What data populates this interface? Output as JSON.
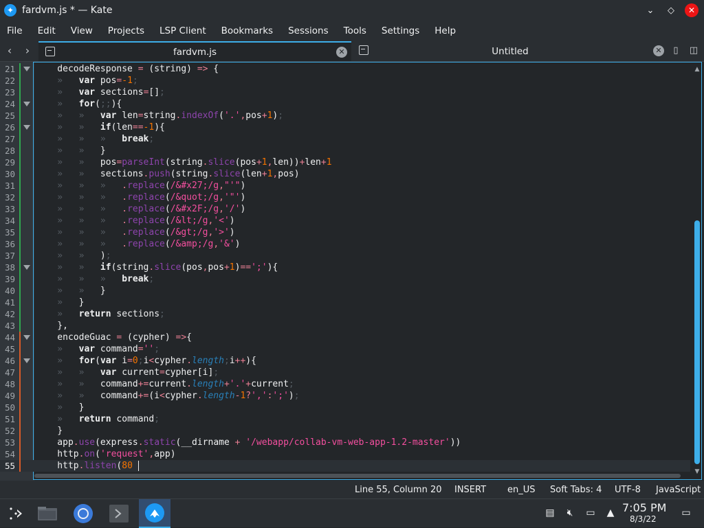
{
  "window": {
    "title": "fardvm.js * — Kate"
  },
  "menu": [
    "File",
    "Edit",
    "View",
    "Projects",
    "LSP Client",
    "Bookmarks",
    "Sessions",
    "Tools",
    "Settings",
    "Help"
  ],
  "tabs": [
    {
      "label": "fardvm.js"
    },
    {
      "label": "Untitled"
    }
  ],
  "editor": {
    "lines": [
      {
        "n": "21",
        "fold": true,
        "mod": "green",
        "tokens": [
          [
            "var",
            "    decodeResponse "
          ],
          [
            "op",
            "="
          ],
          [
            "var",
            " (string) "
          ],
          [
            "op",
            "=>"
          ],
          [
            "var",
            " {"
          ]
        ]
      },
      {
        "n": "22",
        "fold": false,
        "mod": "green",
        "tokens": [
          [
            "ws",
            "    »   "
          ],
          [
            "kw",
            "var"
          ],
          [
            "var",
            " pos"
          ],
          [
            "op",
            "="
          ],
          [
            "num",
            "-1"
          ],
          [
            "ws",
            ";"
          ]
        ]
      },
      {
        "n": "23",
        "fold": false,
        "mod": "green",
        "tokens": [
          [
            "ws",
            "    »   "
          ],
          [
            "kw",
            "var"
          ],
          [
            "var",
            " sections"
          ],
          [
            "op",
            "="
          ],
          [
            "var",
            "[]"
          ],
          [
            "ws",
            ";"
          ]
        ]
      },
      {
        "n": "24",
        "fold": true,
        "mod": "green",
        "tokens": [
          [
            "ws",
            "    »   "
          ],
          [
            "kw",
            "for"
          ],
          [
            "var",
            "("
          ],
          [
            "ws",
            ";;"
          ],
          [
            "var",
            "){"
          ]
        ]
      },
      {
        "n": "25",
        "fold": false,
        "mod": "green",
        "tokens": [
          [
            "ws",
            "    »   »   "
          ],
          [
            "kw",
            "var"
          ],
          [
            "var",
            " len"
          ],
          [
            "op",
            "="
          ],
          [
            "var",
            "string"
          ],
          [
            "op",
            "."
          ],
          [
            "fn",
            "indexOf"
          ],
          [
            "var",
            "("
          ],
          [
            "str",
            "'.'"
          ],
          [
            "op",
            ","
          ],
          [
            "var",
            "pos"
          ],
          [
            "op",
            "+"
          ],
          [
            "num",
            "1"
          ],
          [
            "var",
            ")"
          ],
          [
            "ws",
            ";"
          ]
        ]
      },
      {
        "n": "26",
        "fold": true,
        "mod": "green",
        "tokens": [
          [
            "ws",
            "    »   »   "
          ],
          [
            "kw",
            "if"
          ],
          [
            "var",
            "(len"
          ],
          [
            "op",
            "=="
          ],
          [
            "num",
            "-1"
          ],
          [
            "var",
            "){"
          ]
        ]
      },
      {
        "n": "27",
        "fold": false,
        "mod": "green",
        "tokens": [
          [
            "ws",
            "    »   »   »   "
          ],
          [
            "kw",
            "break"
          ],
          [
            "ws",
            ";"
          ]
        ]
      },
      {
        "n": "28",
        "fold": false,
        "mod": "green",
        "tokens": [
          [
            "ws",
            "    »   »   "
          ],
          [
            "var",
            "}"
          ]
        ]
      },
      {
        "n": "29",
        "fold": false,
        "mod": "green",
        "tokens": [
          [
            "ws",
            "    »   »   "
          ],
          [
            "var",
            "pos"
          ],
          [
            "op",
            "="
          ],
          [
            "fn",
            "parseInt"
          ],
          [
            "var",
            "(string"
          ],
          [
            "op",
            "."
          ],
          [
            "fn",
            "slice"
          ],
          [
            "var",
            "(pos"
          ],
          [
            "op",
            "+"
          ],
          [
            "num",
            "1"
          ],
          [
            "op",
            ","
          ],
          [
            "var",
            "len))"
          ],
          [
            "op",
            "+"
          ],
          [
            "var",
            "len"
          ],
          [
            "op",
            "+"
          ],
          [
            "num",
            "1"
          ]
        ]
      },
      {
        "n": "30",
        "fold": false,
        "mod": "green",
        "tokens": [
          [
            "ws",
            "    »   »   "
          ],
          [
            "var",
            "sections"
          ],
          [
            "op",
            "."
          ],
          [
            "fn",
            "push"
          ],
          [
            "var",
            "(string"
          ],
          [
            "op",
            "."
          ],
          [
            "fn",
            "slice"
          ],
          [
            "var",
            "(len"
          ],
          [
            "op",
            "+"
          ],
          [
            "num",
            "1"
          ],
          [
            "op",
            ","
          ],
          [
            "var",
            "pos)"
          ]
        ]
      },
      {
        "n": "31",
        "fold": false,
        "mod": "green",
        "tokens": [
          [
            "ws",
            "    »   »   »   "
          ],
          [
            "op",
            "."
          ],
          [
            "fn",
            "replace"
          ],
          [
            "var",
            "("
          ],
          [
            "str",
            "/&#x27;/g"
          ],
          [
            "op",
            ","
          ],
          [
            "str",
            "\"'\""
          ],
          [
            "var",
            ")"
          ]
        ]
      },
      {
        "n": "32",
        "fold": false,
        "mod": "green",
        "tokens": [
          [
            "ws",
            "    »   »   »   "
          ],
          [
            "op",
            "."
          ],
          [
            "fn",
            "replace"
          ],
          [
            "var",
            "("
          ],
          [
            "str",
            "/&quot;/g"
          ],
          [
            "op",
            ","
          ],
          [
            "str",
            "'\"'"
          ],
          [
            "var",
            ")"
          ]
        ]
      },
      {
        "n": "33",
        "fold": false,
        "mod": "green",
        "tokens": [
          [
            "ws",
            "    »   »   »   "
          ],
          [
            "op",
            "."
          ],
          [
            "fn",
            "replace"
          ],
          [
            "var",
            "("
          ],
          [
            "str",
            "/&#x2F;/g"
          ],
          [
            "op",
            ","
          ],
          [
            "str",
            "'/'"
          ],
          [
            "var",
            ")"
          ]
        ]
      },
      {
        "n": "34",
        "fold": false,
        "mod": "green",
        "tokens": [
          [
            "ws",
            "    »   »   »   "
          ],
          [
            "op",
            "."
          ],
          [
            "fn",
            "replace"
          ],
          [
            "var",
            "("
          ],
          [
            "str",
            "/&lt;/g"
          ],
          [
            "op",
            ","
          ],
          [
            "str",
            "'<'"
          ],
          [
            "var",
            ")"
          ]
        ]
      },
      {
        "n": "35",
        "fold": false,
        "mod": "green",
        "tokens": [
          [
            "ws",
            "    »   »   »   "
          ],
          [
            "op",
            "."
          ],
          [
            "fn",
            "replace"
          ],
          [
            "var",
            "("
          ],
          [
            "str",
            "/&gt;/g"
          ],
          [
            "op",
            ","
          ],
          [
            "str",
            "'>'"
          ],
          [
            "var",
            ")"
          ]
        ]
      },
      {
        "n": "36",
        "fold": false,
        "mod": "green",
        "tokens": [
          [
            "ws",
            "    »   »   »   "
          ],
          [
            "op",
            "."
          ],
          [
            "fn",
            "replace"
          ],
          [
            "var",
            "("
          ],
          [
            "str",
            "/&amp;/g"
          ],
          [
            "op",
            ","
          ],
          [
            "str",
            "'&'"
          ],
          [
            "var",
            ")"
          ]
        ]
      },
      {
        "n": "37",
        "fold": false,
        "mod": "green",
        "tokens": [
          [
            "ws",
            "    »   »   "
          ],
          [
            "var",
            ")"
          ],
          [
            "ws",
            ";"
          ]
        ]
      },
      {
        "n": "38",
        "fold": true,
        "mod": "green",
        "tokens": [
          [
            "ws",
            "    »   »   "
          ],
          [
            "kw",
            "if"
          ],
          [
            "var",
            "(string"
          ],
          [
            "op",
            "."
          ],
          [
            "fn",
            "slice"
          ],
          [
            "var",
            "(pos"
          ],
          [
            "op",
            ","
          ],
          [
            "var",
            "pos"
          ],
          [
            "op",
            "+"
          ],
          [
            "num",
            "1"
          ],
          [
            "var",
            ")"
          ],
          [
            "op",
            "=="
          ],
          [
            "str",
            "';'"
          ],
          [
            "var",
            "){"
          ]
        ]
      },
      {
        "n": "39",
        "fold": false,
        "mod": "green",
        "tokens": [
          [
            "ws",
            "    »   »   »   "
          ],
          [
            "kw",
            "break"
          ],
          [
            "ws",
            ";"
          ]
        ]
      },
      {
        "n": "40",
        "fold": false,
        "mod": "green",
        "tokens": [
          [
            "ws",
            "    »   »   "
          ],
          [
            "var",
            "}"
          ]
        ]
      },
      {
        "n": "41",
        "fold": false,
        "mod": "green",
        "tokens": [
          [
            "ws",
            "    »   "
          ],
          [
            "var",
            "}"
          ]
        ]
      },
      {
        "n": "42",
        "fold": false,
        "mod": "green",
        "tokens": [
          [
            "ws",
            "    »   "
          ],
          [
            "kw",
            "return"
          ],
          [
            "var",
            " sections"
          ],
          [
            "ws",
            ";"
          ]
        ]
      },
      {
        "n": "43",
        "fold": false,
        "mod": "green",
        "tokens": [
          [
            "var",
            "    },"
          ]
        ]
      },
      {
        "n": "44",
        "fold": true,
        "mod": "orange",
        "tokens": [
          [
            "var",
            "    encodeGuac "
          ],
          [
            "op",
            "="
          ],
          [
            "var",
            " (cypher) "
          ],
          [
            "op",
            "=>"
          ],
          [
            "var",
            "{"
          ]
        ]
      },
      {
        "n": "45",
        "fold": false,
        "mod": "orange",
        "tokens": [
          [
            "ws",
            "    »   "
          ],
          [
            "kw",
            "var"
          ],
          [
            "var",
            " command"
          ],
          [
            "op",
            "="
          ],
          [
            "str",
            "''"
          ],
          [
            "ws",
            ";"
          ]
        ]
      },
      {
        "n": "46",
        "fold": true,
        "mod": "orange",
        "tokens": [
          [
            "ws",
            "    »   "
          ],
          [
            "kw",
            "for"
          ],
          [
            "var",
            "("
          ],
          [
            "kw",
            "var"
          ],
          [
            "var",
            " i"
          ],
          [
            "op",
            "="
          ],
          [
            "num",
            "0"
          ],
          [
            "ws",
            ";"
          ],
          [
            "var",
            "i"
          ],
          [
            "op",
            "<"
          ],
          [
            "var",
            "cypher"
          ],
          [
            "op",
            "."
          ],
          [
            "prop",
            "length"
          ],
          [
            "ws",
            ";"
          ],
          [
            "var",
            "i"
          ],
          [
            "op",
            "++"
          ],
          [
            "var",
            "){"
          ]
        ]
      },
      {
        "n": "47",
        "fold": false,
        "mod": "orange",
        "tokens": [
          [
            "ws",
            "    »   »   "
          ],
          [
            "kw",
            "var"
          ],
          [
            "var",
            " current"
          ],
          [
            "op",
            "="
          ],
          [
            "var",
            "cypher[i]"
          ],
          [
            "ws",
            ";"
          ]
        ]
      },
      {
        "n": "48",
        "fold": false,
        "mod": "orange",
        "tokens": [
          [
            "ws",
            "    »   »   "
          ],
          [
            "var",
            "command"
          ],
          [
            "op",
            "+="
          ],
          [
            "var",
            "current"
          ],
          [
            "op",
            "."
          ],
          [
            "prop",
            "length"
          ],
          [
            "op",
            "+"
          ],
          [
            "str",
            "'.'"
          ],
          [
            "op",
            "+"
          ],
          [
            "var",
            "current"
          ],
          [
            "ws",
            ";"
          ]
        ]
      },
      {
        "n": "49",
        "fold": false,
        "mod": "orange",
        "tokens": [
          [
            "ws",
            "    »   »   "
          ],
          [
            "var",
            "command"
          ],
          [
            "op",
            "+="
          ],
          [
            "var",
            "(i"
          ],
          [
            "op",
            "<"
          ],
          [
            "var",
            "cypher"
          ],
          [
            "op",
            "."
          ],
          [
            "prop",
            "length"
          ],
          [
            "op",
            "-"
          ],
          [
            "num",
            "1"
          ],
          [
            "op",
            "?"
          ],
          [
            "str",
            "','"
          ],
          [
            "op",
            ":"
          ],
          [
            "str",
            "';'"
          ],
          [
            "var",
            ")"
          ],
          [
            "ws",
            ";"
          ]
        ]
      },
      {
        "n": "50",
        "fold": false,
        "mod": "orange",
        "tokens": [
          [
            "ws",
            "    »   "
          ],
          [
            "var",
            "}"
          ]
        ]
      },
      {
        "n": "51",
        "fold": false,
        "mod": "orange",
        "tokens": [
          [
            "ws",
            "    »   "
          ],
          [
            "kw",
            "return"
          ],
          [
            "var",
            " command"
          ],
          [
            "ws",
            ";"
          ]
        ]
      },
      {
        "n": "52",
        "fold": false,
        "mod": "orange",
        "tokens": [
          [
            "var",
            "    }"
          ]
        ]
      },
      {
        "n": "53",
        "fold": false,
        "mod": "orange",
        "tokens": [
          [
            "var",
            "    app"
          ],
          [
            "op",
            "."
          ],
          [
            "fn",
            "use"
          ],
          [
            "var",
            "(express"
          ],
          [
            "op",
            "."
          ],
          [
            "fn",
            "static"
          ],
          [
            "var",
            "(__dirname "
          ],
          [
            "op",
            "+"
          ],
          [
            "str",
            " '/webapp/collab-vm-web-app-1.2-master'"
          ],
          [
            "var",
            "))"
          ]
        ]
      },
      {
        "n": "54",
        "fold": false,
        "mod": "orange",
        "tokens": [
          [
            "var",
            "    http"
          ],
          [
            "op",
            "."
          ],
          [
            "fn",
            "on"
          ],
          [
            "var",
            "("
          ],
          [
            "str",
            "'request'"
          ],
          [
            "op",
            ","
          ],
          [
            "var",
            "app)"
          ]
        ]
      },
      {
        "n": "55",
        "fold": false,
        "mod": "orange",
        "current": true,
        "tokens": [
          [
            "var",
            "    http"
          ],
          [
            "op",
            "."
          ],
          [
            "fn",
            "listen"
          ],
          [
            "var",
            "("
          ],
          [
            "num",
            "80"
          ],
          [
            "ws",
            " "
          ]
        ]
      }
    ]
  },
  "status": {
    "position": "Line 55, Column 20",
    "mode": "INSERT",
    "dictionary": "en_US",
    "indent": "Soft Tabs: 4",
    "encoding": "UTF-8",
    "language": "JavaScript"
  },
  "taskbar": {
    "time": "7:05 PM",
    "date": "8/3/22"
  }
}
